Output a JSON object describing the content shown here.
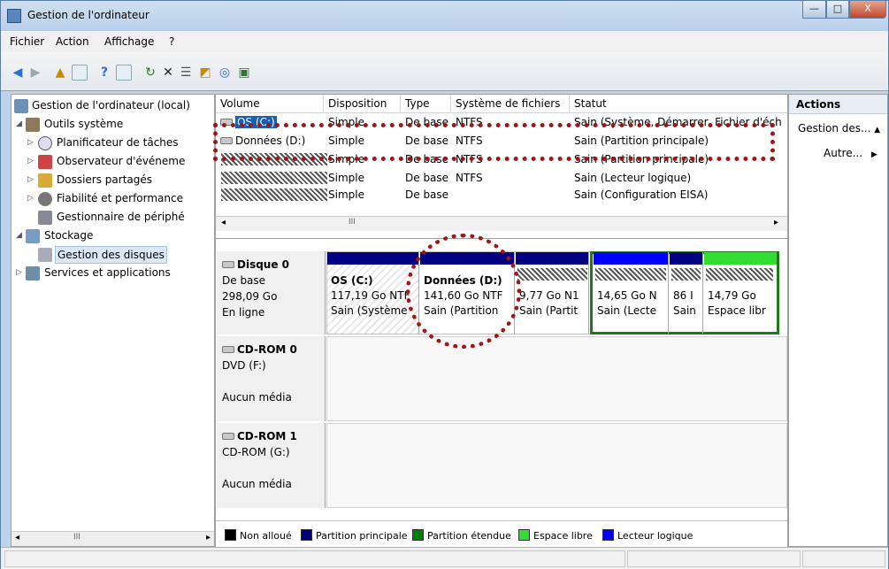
{
  "window": {
    "title": "Gestion de l'ordinateur"
  },
  "titlebar_buttons": {
    "minimize": "—",
    "maximize": "□",
    "close": "X"
  },
  "menu": [
    "Fichier",
    "Action",
    "Affichage",
    "?"
  ],
  "toolbar": [
    "back-icon",
    "forward-icon",
    "up-folder-icon",
    "console-tree-icon",
    "help-icon",
    "show-hide-icon",
    "refresh-icon",
    "delete-icon",
    "properties-icon",
    "open-icon",
    "search-icon",
    "export-icon"
  ],
  "tree": [
    {
      "label": "Gestion de l'ordinateur (local)",
      "level": 0,
      "expander": ""
    },
    {
      "label": "Outils système",
      "level": 1,
      "expander": "◢"
    },
    {
      "label": "Planificateur de tâches",
      "level": 2,
      "expander": "▷"
    },
    {
      "label": "Observateur d'événeme",
      "level": 2,
      "expander": "▷"
    },
    {
      "label": "Dossiers partagés",
      "level": 2,
      "expander": "▷"
    },
    {
      "label": "Fiabilité et performance",
      "level": 2,
      "expander": "▷"
    },
    {
      "label": "Gestionnaire de périphé",
      "level": 2,
      "expander": ""
    },
    {
      "label": "Stockage",
      "level": 1,
      "expander": "◢"
    },
    {
      "label": "Gestion des disques",
      "level": 2,
      "expander": ""
    },
    {
      "label": "Services et applications",
      "level": 1,
      "expander": "▷"
    }
  ],
  "volumes": {
    "columns": [
      "Volume",
      "Disposition",
      "Type",
      "Système de fichiers",
      "Statut"
    ],
    "rows": [
      {
        "volume": "OS (C:)",
        "disposition": "Simple",
        "type": "De base",
        "fs": "NTFS",
        "status": "Sain (Système, Démarrer, Fichier d'éch"
      },
      {
        "volume": "Données (D:)",
        "disposition": "Simple",
        "type": "De base",
        "fs": "NTFS",
        "status": "Sain (Partition principale)"
      },
      {
        "volume": "",
        "disposition": "Simple",
        "type": "De base",
        "fs": "NTFS",
        "status": "Sain (Partition principale)"
      },
      {
        "volume": "",
        "disposition": "Simple",
        "type": "De base",
        "fs": "NTFS",
        "status": "Sain (Lecteur logique)"
      },
      {
        "volume": "",
        "disposition": "Simple",
        "type": "De base",
        "fs": "",
        "status": "Sain (Configuration EISA)"
      }
    ]
  },
  "disks": [
    {
      "name": "Disque 0",
      "line2": "De base",
      "line3": "298,09 Go",
      "line4": "En ligne"
    },
    {
      "name": "CD-ROM 0",
      "line2": "DVD (F:)",
      "line3": "",
      "line4": "Aucun média"
    },
    {
      "name": "CD-ROM 1",
      "line2": "CD-ROM (G:)",
      "line3": "",
      "line4": "Aucun média"
    }
  ],
  "partitions": [
    {
      "title": "OS  (C:)",
      "size": "117,19 Go NTF",
      "status": "Sain (Système"
    },
    {
      "title": "Données  (D:)",
      "size": "141,60 Go NTF",
      "status": "Sain (Partition"
    },
    {
      "title": "",
      "size": "9,77 Go N1",
      "status": "Sain (Partit"
    },
    {
      "title": "",
      "size": "14,65 Go N",
      "status": "Sain (Lecte"
    },
    {
      "title": "",
      "size": "86 I",
      "status": "Sain"
    },
    {
      "title": "",
      "size": "14,79 Go",
      "status": "Espace libr"
    }
  ],
  "legend": [
    {
      "label": "Non alloué",
      "color": "#000000"
    },
    {
      "label": "Partition principale",
      "color": "#000080"
    },
    {
      "label": "Partition étendue",
      "color": "#008000"
    },
    {
      "label": "Espace libre",
      "color": "#33dd33"
    },
    {
      "label": "Lecteur logique",
      "color": "#0000ff"
    }
  ],
  "actions": {
    "header": "Actions",
    "item1": "Gestion des...",
    "item2": "Autre..."
  },
  "scroll": {
    "thumb_marker": "III"
  }
}
